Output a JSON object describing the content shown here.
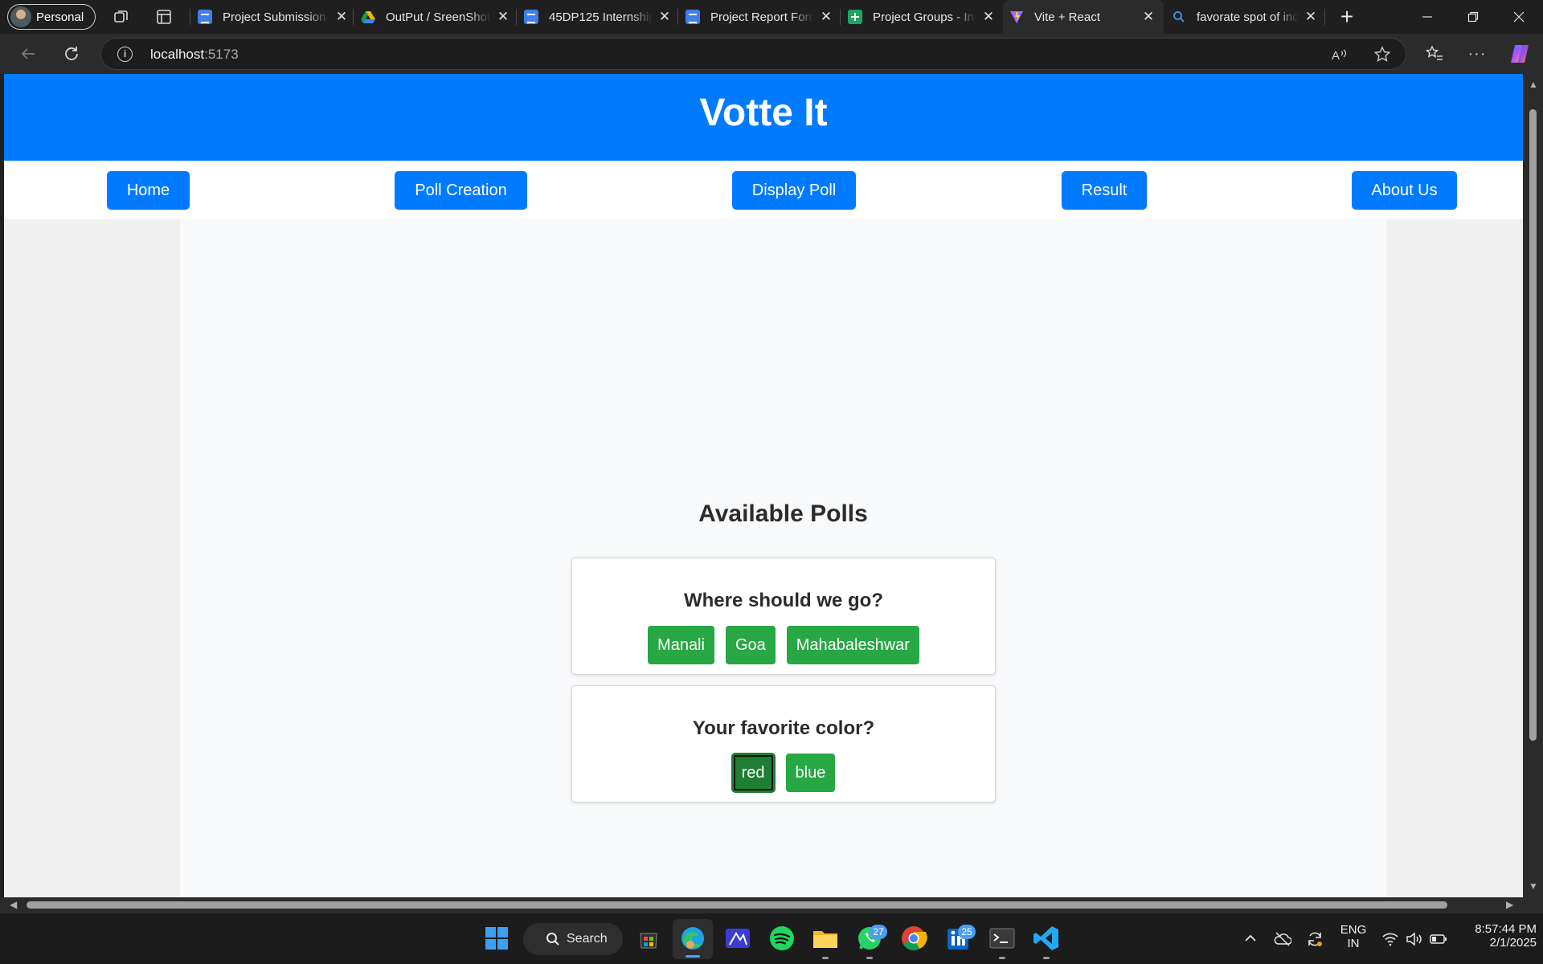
{
  "browser": {
    "profile_label": "Personal",
    "tabs": [
      {
        "title": "Project Submission",
        "icon": "docs-icon"
      },
      {
        "title": "OutPut / SreenShot",
        "icon": "drive-icon"
      },
      {
        "title": "45DP125 Internship",
        "icon": "docs-icon"
      },
      {
        "title": "Project Report Form",
        "icon": "docs-icon"
      },
      {
        "title": "Project Groups - In",
        "icon": "sheets-icon"
      },
      {
        "title": "Vite + React",
        "icon": "vite-icon",
        "active": true
      },
      {
        "title": "favorate spot of ind",
        "icon": "search-icon"
      }
    ],
    "new_tab_glyph": "+",
    "url_host": "localhost",
    "url_port": ":5173"
  },
  "site": {
    "title": "Votte It",
    "nav": [
      "Home",
      "Poll Creation",
      "Display Poll",
      "Result",
      "About Us"
    ],
    "section_title": "Available Polls",
    "polls": [
      {
        "question": "Where should we go?",
        "options": [
          "Manali",
          "Goa",
          "Mahabaleshwar"
        ]
      },
      {
        "question": "Your favorite color?",
        "options": [
          "red",
          "blue"
        ],
        "selected": "red"
      }
    ],
    "colors": {
      "header_blue": "#007bff",
      "option_green": "#28a745",
      "option_selected": "#1e7e34"
    }
  },
  "taskbar": {
    "search_label": "Search",
    "whatsapp_badge": "27",
    "linkedin_badge": "25",
    "language_top": "ENG",
    "language_bottom": "IN",
    "time": "8:57:44 PM",
    "date": "2/1/2025"
  }
}
